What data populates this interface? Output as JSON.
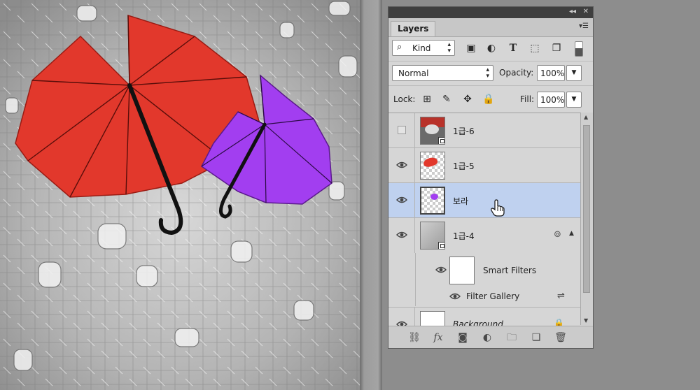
{
  "panel": {
    "tab_label": "Layers",
    "filter_kind": "Kind",
    "blend_mode": "Normal",
    "opacity_label": "Opacity:",
    "opacity_value": "100%",
    "lock_label": "Lock:",
    "fill_label": "Fill:",
    "fill_value": "100%"
  },
  "layers": [
    {
      "name": "1급-6",
      "visible": false,
      "selected": false,
      "thumb": "photo"
    },
    {
      "name": "1급-5",
      "visible": true,
      "selected": false,
      "thumb": "red-umbrella"
    },
    {
      "name": "보라",
      "visible": true,
      "selected": true,
      "thumb": "purple-umbrella"
    },
    {
      "name": "1급-4",
      "visible": true,
      "selected": false,
      "thumb": "gray-texture"
    },
    {
      "name": "Background",
      "visible": true,
      "selected": false,
      "thumb": "white"
    }
  ],
  "smart_filters": {
    "label": "Smart Filters",
    "filter": "Filter Gallery"
  },
  "colors": {
    "selected_row": "#bfd1ef",
    "red_umbrella": "#e2382c",
    "purple_umbrella": "#a23ef0"
  }
}
